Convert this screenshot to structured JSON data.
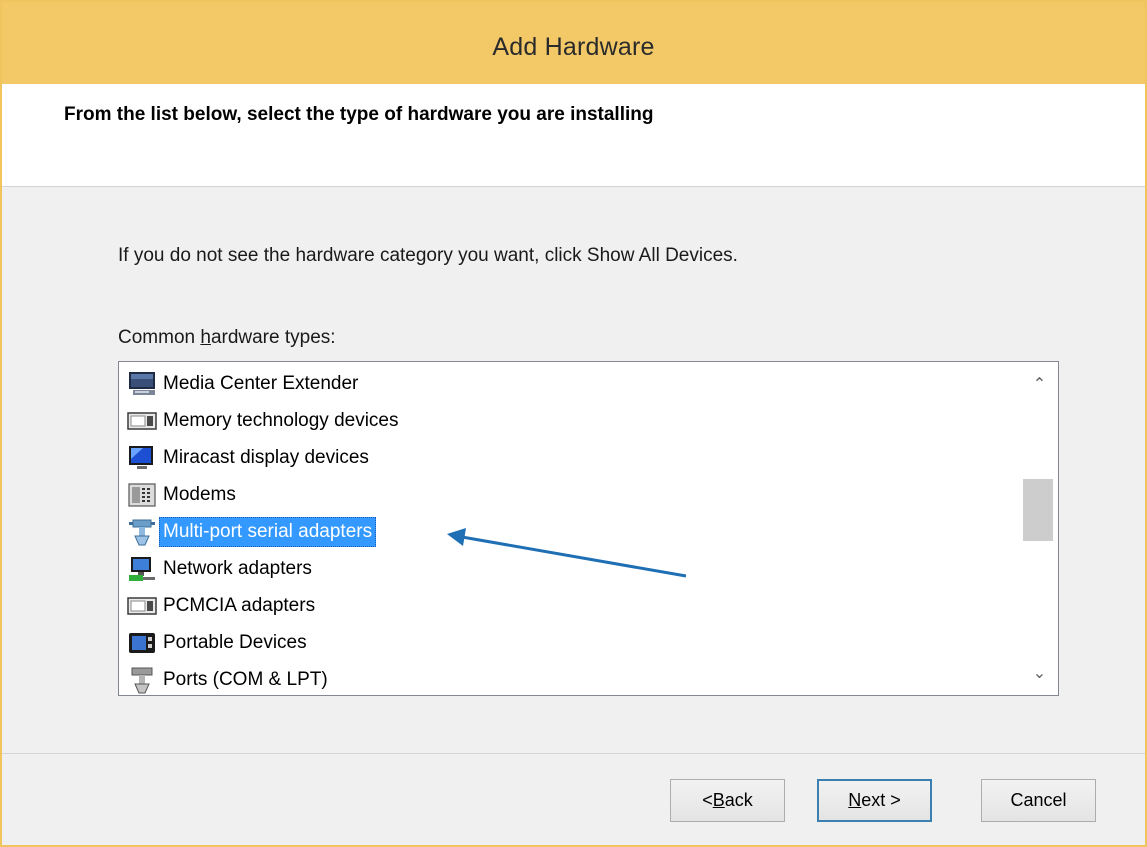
{
  "window": {
    "title": "Add Hardware"
  },
  "header": {
    "heading": "From the list below, select the type of hardware you are installing"
  },
  "instruction": "If you do not see the hardware category you want, click Show All Devices.",
  "list_label": {
    "before": "Common ",
    "underlined": "h",
    "after": "ardware types:"
  },
  "hardware_types": [
    {
      "label": "Media Center Extender",
      "icon": "media-center-icon",
      "selected": false
    },
    {
      "label": "Memory technology devices",
      "icon": "memory-device-icon",
      "selected": false
    },
    {
      "label": "Miracast display devices",
      "icon": "display-icon",
      "selected": false
    },
    {
      "label": "Modems",
      "icon": "modem-icon",
      "selected": false
    },
    {
      "label": "Multi-port serial adapters",
      "icon": "serial-adapter-icon",
      "selected": true
    },
    {
      "label": "Network adapters",
      "icon": "network-adapter-icon",
      "selected": false
    },
    {
      "label": "PCMCIA adapters",
      "icon": "pcmcia-icon",
      "selected": false
    },
    {
      "label": "Portable Devices",
      "icon": "portable-device-icon",
      "selected": false
    },
    {
      "label": "Ports (COM & LPT)",
      "icon": "port-icon",
      "selected": false
    }
  ],
  "scrollbar": {
    "up": "⌃",
    "down": "⌄"
  },
  "buttons": {
    "back": {
      "prefix": "< ",
      "underlined": "B",
      "rest": "ack"
    },
    "next": {
      "underlined": "N",
      "rest": "ext >"
    },
    "cancel": "Cancel"
  },
  "colors": {
    "titlebar": "#f3c968",
    "selection": "#3399ff",
    "annotation_arrow": "#1f6fb5"
  }
}
